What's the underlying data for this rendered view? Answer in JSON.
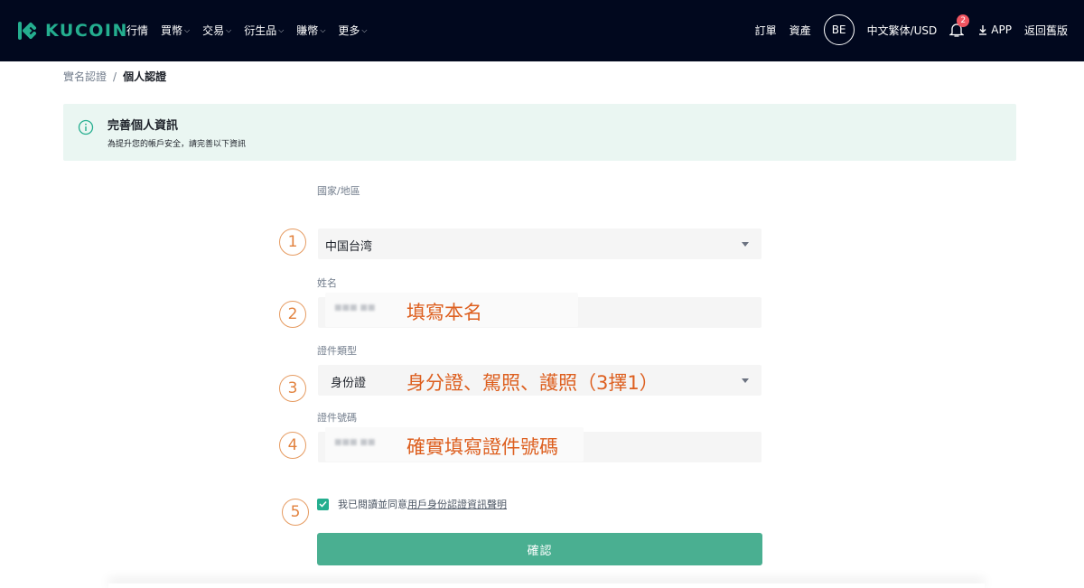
{
  "brand": {
    "name": "KUCOIN",
    "color": "#24ae8f"
  },
  "nav": {
    "items": [
      {
        "label": "行情",
        "has_caret": false
      },
      {
        "label": "買幣",
        "has_caret": true
      },
      {
        "label": "交易",
        "has_caret": true
      },
      {
        "label": "衍生品",
        "has_caret": true
      },
      {
        "label": "賺幣",
        "has_caret": true
      },
      {
        "label": "更多",
        "has_caret": true
      }
    ],
    "right": {
      "orders": "訂單",
      "assets": "資產",
      "avatar": "BE",
      "locale": "中文繁体/USD",
      "notifications_count": "2",
      "app": "APP",
      "old_version": "返回舊版"
    }
  },
  "breadcrumb": {
    "parent": "實名認證",
    "separator": "/",
    "current": "個人認證"
  },
  "notice": {
    "title": "完善個人資訊",
    "subtitle": "為提升您的帳戶安全，請完善以下資訊"
  },
  "form": {
    "country": {
      "label": "國家/地區",
      "value": "中国台湾",
      "step": "1"
    },
    "name": {
      "label": "姓名",
      "note": "填寫本名",
      "step": "2"
    },
    "id_type": {
      "label": "證件類型",
      "value": "身份證",
      "note": "身分證、駕照、護照（3擇1）",
      "step": "3"
    },
    "id_number": {
      "label": "證件號碼",
      "note": "確實填寫證件號碼",
      "step": "4"
    },
    "agreement": {
      "text": "我已閱讀並同意",
      "link": "用戶身份認證資訊聲明",
      "checked": true,
      "step": "5"
    },
    "confirm_label": "確認"
  },
  "colors": {
    "accent": "#24ae8f",
    "button": "#4aaf91",
    "note": "#dd5f1f",
    "header_bg": "#01081e",
    "badge": "#f05561"
  }
}
